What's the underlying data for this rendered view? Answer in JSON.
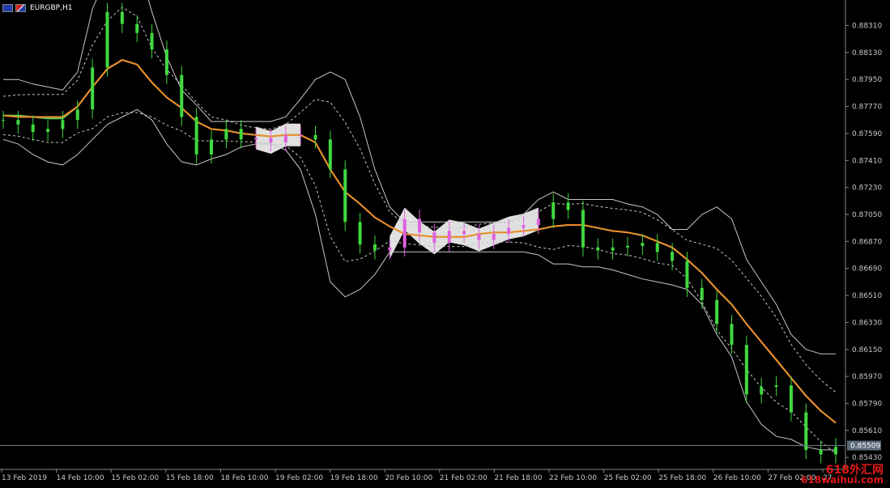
{
  "title": "EURGBP,H1",
  "price_label": "0.85509",
  "watermark": {
    "line1": "618外汇网",
    "line2": "618waihui.com"
  },
  "colors": {
    "background": "#000000",
    "candle": "#3fd93f",
    "flat_candle": "#e060e0",
    "bands": "#c8c8c8",
    "ma_fast": "#58c858",
    "ma_slow": "#f08c28",
    "flat_zone": "#e0e0e0",
    "price_line": "#6a7a8a",
    "axis_text": "#c8c8c8"
  },
  "chart_data": {
    "type": "line",
    "symbol": "EURGBP",
    "timeframe": "H1",
    "ylim": [
      0.8535,
      0.8848
    ],
    "y_ticks": [
      "0.88310",
      "0.88130",
      "0.87950",
      "0.87770",
      "0.87590",
      "0.87410",
      "0.87230",
      "0.87050",
      "0.86870",
      "0.86690",
      "0.86510",
      "0.86330",
      "0.86150",
      "0.85970",
      "0.85790",
      "0.85610",
      "0.85430"
    ],
    "x_ticks": [
      "13 Feb 2019",
      "14 Feb 10:00",
      "15 Feb 02:00",
      "15 Feb 18:00",
      "18 Feb 10:00",
      "19 Feb 02:00",
      "19 Feb 18:00",
      "20 Feb 10:00",
      "21 Feb 02:00",
      "21 Feb 18:00",
      "22 Feb 10:00",
      "25 Feb 02:00",
      "25 Feb 18:00",
      "26 Feb 10:00",
      "27 Feb 02:00",
      "27"
    ],
    "current_price": 0.85509,
    "series": [
      {
        "role": "close",
        "values": [
          0.8768,
          0.8765,
          0.876,
          0.8762,
          0.8768,
          0.8775,
          0.8803,
          0.884,
          0.8832,
          0.8826,
          0.8815,
          0.8798,
          0.877,
          0.8745,
          0.8755,
          0.8762,
          0.8755,
          0.8756,
          0.8753,
          0.8758,
          0.8758,
          0.8755,
          0.8735,
          0.87,
          0.8685,
          0.8681,
          0.8683,
          0.8702,
          0.8693,
          0.8686,
          0.8694,
          0.8692,
          0.8688,
          0.8692,
          0.8696,
          0.8698,
          0.8702,
          0.8713,
          0.8708,
          0.8683,
          0.8681,
          0.8683,
          0.8684,
          0.8686,
          0.868,
          0.8674,
          0.8656,
          0.8648,
          0.8632,
          0.8618,
          0.8585,
          0.859,
          0.8591,
          0.8573,
          0.8548,
          0.8545,
          0.855
        ]
      },
      {
        "role": "ma_fast",
        "values": [
          0.8771,
          0.8771,
          0.877,
          0.8769,
          0.8769,
          0.8777,
          0.879,
          0.8802,
          0.8808,
          0.8805,
          0.8793,
          0.8783,
          0.8776,
          0.8767,
          0.8762,
          0.8761,
          0.8759,
          0.8758,
          0.8757,
          0.8758,
          0.8758,
          0.8753,
          0.8735,
          0.872,
          0.8712,
          0.8703,
          0.8697,
          0.8692,
          0.8691,
          0.869,
          0.869,
          0.869,
          0.8692,
          0.8693,
          0.8693,
          0.8694,
          0.8695,
          0.8697,
          0.8698,
          0.8698,
          0.8696,
          0.8694,
          0.8693,
          0.8691,
          0.8687,
          0.8683,
          0.8675,
          0.8666,
          0.8655,
          0.8645,
          0.8632,
          0.862,
          0.8608,
          0.8596,
          0.8584,
          0.8574,
          0.8566
        ]
      },
      {
        "role": "ma_slow",
        "values": [
          0.8771,
          0.877,
          0.877,
          0.877,
          0.877,
          0.8777,
          0.879,
          0.8802,
          0.8808,
          0.8805,
          0.8793,
          0.8783,
          0.8776,
          0.8767,
          0.8762,
          0.8761,
          0.8759,
          0.8758,
          0.8757,
          0.8758,
          0.8758,
          0.8753,
          0.8735,
          0.872,
          0.8712,
          0.8703,
          0.8697,
          0.8692,
          0.8691,
          0.869,
          0.869,
          0.869,
          0.8692,
          0.8693,
          0.8693,
          0.8694,
          0.8695,
          0.8697,
          0.8698,
          0.8698,
          0.8696,
          0.8694,
          0.8693,
          0.8691,
          0.8687,
          0.8683,
          0.8675,
          0.8666,
          0.8655,
          0.8645,
          0.8632,
          0.862,
          0.8608,
          0.8596,
          0.8584,
          0.8574,
          0.8566
        ]
      },
      {
        "role": "upper_band",
        "values": [
          0.8795,
          0.8795,
          0.8792,
          0.879,
          0.8788,
          0.88,
          0.8842,
          0.8865,
          0.888,
          0.8875,
          0.884,
          0.881,
          0.8788,
          0.8778,
          0.8767,
          0.8767,
          0.8767,
          0.8767,
          0.8767,
          0.877,
          0.8782,
          0.8795,
          0.88,
          0.8795,
          0.877,
          0.8735,
          0.871,
          0.87,
          0.87,
          0.87,
          0.87,
          0.87,
          0.87,
          0.87,
          0.87,
          0.8705,
          0.8715,
          0.872,
          0.8715,
          0.8715,
          0.8715,
          0.8715,
          0.8712,
          0.871,
          0.8705,
          0.8695,
          0.8695,
          0.8705,
          0.871,
          0.8702,
          0.8675,
          0.866,
          0.8645,
          0.8625,
          0.8615,
          0.8612,
          0.8612
        ]
      },
      {
        "role": "lower_band",
        "values": [
          0.8755,
          0.8752,
          0.8745,
          0.874,
          0.8738,
          0.8745,
          0.8755,
          0.8765,
          0.877,
          0.8775,
          0.8768,
          0.8752,
          0.874,
          0.8738,
          0.8742,
          0.8745,
          0.875,
          0.8752,
          0.8752,
          0.8748,
          0.8735,
          0.8705,
          0.866,
          0.865,
          0.8655,
          0.8665,
          0.868,
          0.868,
          0.868,
          0.868,
          0.868,
          0.868,
          0.868,
          0.868,
          0.868,
          0.868,
          0.8678,
          0.8672,
          0.8672,
          0.867,
          0.867,
          0.8668,
          0.8665,
          0.8662,
          0.866,
          0.8658,
          0.8655,
          0.8645,
          0.8625,
          0.861,
          0.858,
          0.8565,
          0.8557,
          0.8555,
          0.855,
          0.8548,
          0.8548
        ]
      }
    ]
  }
}
